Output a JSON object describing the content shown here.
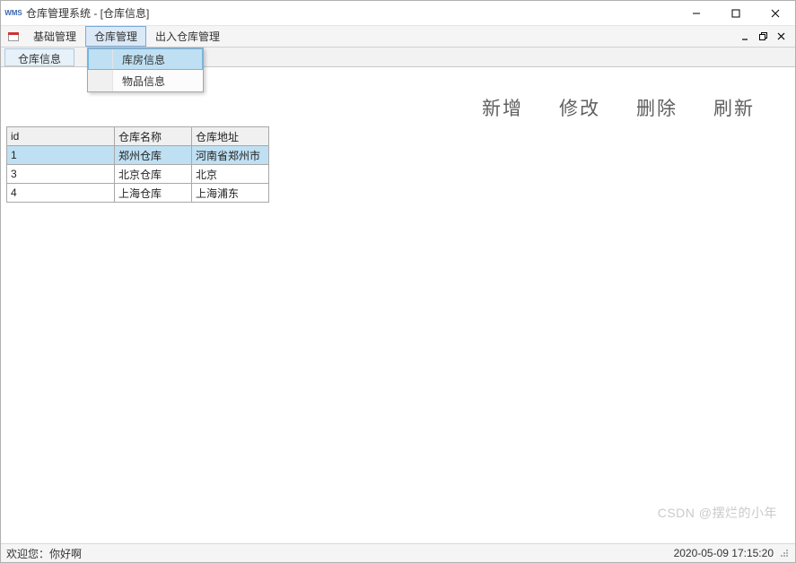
{
  "window": {
    "icon_text": "WMS",
    "title": "仓库管理系统 - [仓库信息]"
  },
  "menubar": {
    "items": [
      {
        "label": "基础管理"
      },
      {
        "label": "仓库管理"
      },
      {
        "label": "出入仓库管理"
      }
    ]
  },
  "dropdown": {
    "items": [
      {
        "label": "库房信息",
        "selected": true
      },
      {
        "label": "物品信息",
        "selected": false
      }
    ]
  },
  "tab": {
    "label": "仓库信息"
  },
  "actions": {
    "add": "新增",
    "edit": "修改",
    "delete": "删除",
    "refresh": "刷新"
  },
  "grid": {
    "columns": [
      "id",
      "仓库名称",
      "仓库地址"
    ],
    "rows": [
      {
        "id": "1",
        "name": "郑州仓库",
        "addr": "河南省郑州市",
        "selected": true
      },
      {
        "id": "3",
        "name": "北京仓库",
        "addr": "北京",
        "selected": false
      },
      {
        "id": "4",
        "name": "上海仓库",
        "addr": "上海浦东",
        "selected": false
      }
    ]
  },
  "statusbar": {
    "welcome_label": "欢迎您：",
    "welcome_user": "你好啊",
    "timestamp": "2020-05-09 17:15:20"
  },
  "watermark": "CSDN @摆烂的小年"
}
